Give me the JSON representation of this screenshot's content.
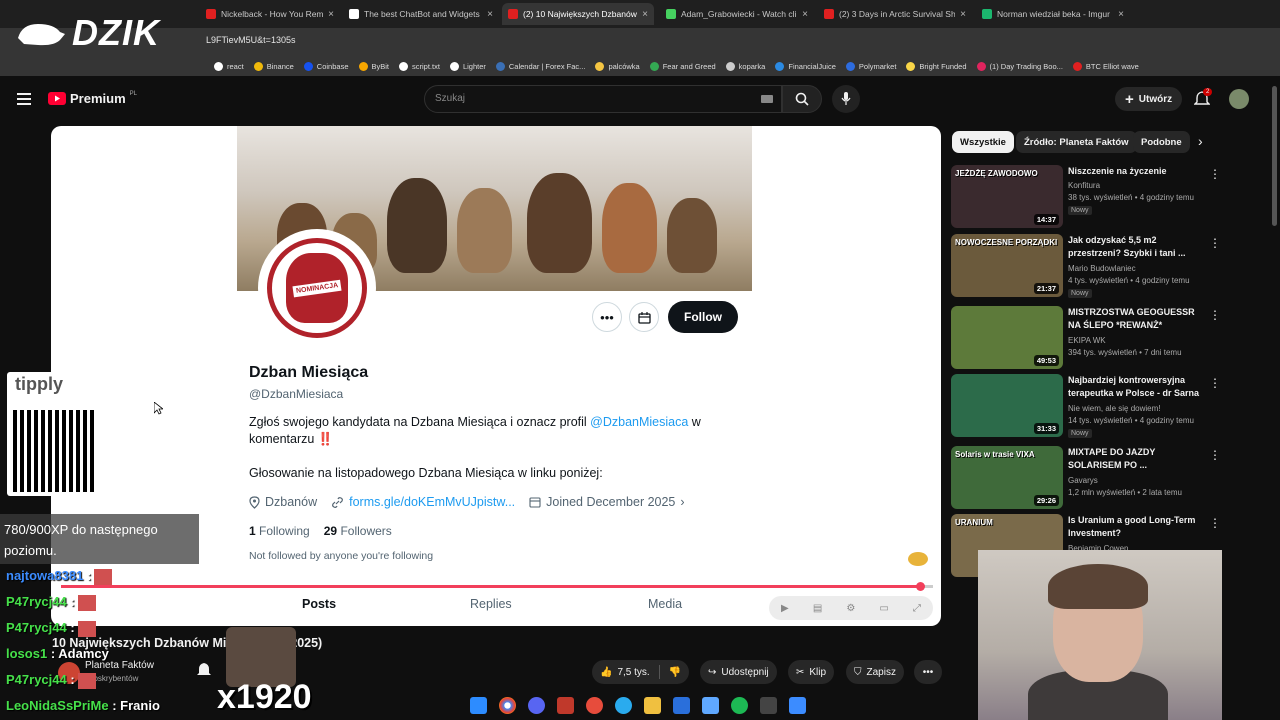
{
  "overlay": {
    "logo": "DZIK",
    "tipply": "tipply",
    "xp_text": "780/900XP do następnego poziomu.",
    "counter": "x1920",
    "chat": [
      {
        "nick": "najtowa8381",
        "text": ":"
      },
      {
        "nick": "P47rycj44",
        "text": ":"
      },
      {
        "nick": "P47rycj44",
        "text": ":"
      },
      {
        "nick": "losos1",
        "text": ": Adamcy"
      },
      {
        "nick": "P47rycj44",
        "text": ":"
      },
      {
        "nick": "LeoNidaSsPriMe",
        "text": ": Franio"
      }
    ]
  },
  "browser": {
    "tabs": [
      {
        "label": "Nickelback - How You Remi",
        "color": "#e02020"
      },
      {
        "label": "The best ChatBot and Widgets",
        "color": "#ffffff"
      },
      {
        "label": "(2) 10 Największych Dzbanów",
        "color": "#e02020"
      },
      {
        "label": "Adam_Grabowiecki - Watch cli",
        "color": "#46d160"
      },
      {
        "label": "(2) 3 Days in Arctic Survival She",
        "color": "#e02020"
      },
      {
        "label": "Norman wiedział beka - Imgur",
        "color": "#1bb76e"
      }
    ],
    "url": "L9FTievM5U&t=1305s",
    "bookmarks": [
      {
        "label": "react",
        "color": "#ffffff"
      },
      {
        "label": "Binance",
        "color": "#f0b90b"
      },
      {
        "label": "Coinbase",
        "color": "#1652f0"
      },
      {
        "label": "ByBit",
        "color": "#f7a600"
      },
      {
        "label": "script.txt",
        "color": "#ffffff"
      },
      {
        "label": "Lighter",
        "color": "#ffffff"
      },
      {
        "label": "Calendar | Forex Fac...",
        "color": "#3a6fb5"
      },
      {
        "label": "palcówka",
        "color": "#f4c542"
      },
      {
        "label": "Fear and Greed",
        "color": "#34a853"
      },
      {
        "label": "koparka",
        "color": "#cccccc"
      },
      {
        "label": "FinancialJuice",
        "color": "#2b8ae2"
      },
      {
        "label": "Polymarket",
        "color": "#2d6cdf"
      },
      {
        "label": "Bright Funded",
        "color": "#f9d648"
      },
      {
        "label": "(1) Day Trading Boo...",
        "color": "#e0245e"
      },
      {
        "label": "BTC Elliot wave",
        "color": "#e02020"
      }
    ]
  },
  "youtube": {
    "brand": "Premium",
    "brand_region": "PL",
    "search_placeholder": "Szukaj",
    "create_label": "Utwórz",
    "notif_count": "2",
    "chips": [
      "Wszystkie",
      "Źródło: Planeta Faktów",
      "Podobne"
    ],
    "video_title": "10 Największych Dzbanów Mi... (...dzień 2025)",
    "channel": "Planeta Faktów",
    "subs": "subskrybentów",
    "likes": "7,5 tys.",
    "share": "Udostępnij",
    "clip": "Klip",
    "save": "Zapisz",
    "recommended": [
      {
        "title": "Niszczenie na życzenie",
        "channel": "Konfitura",
        "meta": "38 tys. wyświetleń • 4 godziny temu",
        "badge": "Nowy",
        "duration": "14:37",
        "thumb": "#3a2a2e",
        "thumb_text": "JEŻDŻĘ ZAWODOWO"
      },
      {
        "title": "Jak odzyskać 5,5 m2 przestrzeni? Szybki i tani ...",
        "channel": "Mario Budowlaniec",
        "meta": "4 tys. wyświetleń • 4 godziny temu",
        "badge": "Nowy",
        "duration": "21:37",
        "thumb": "#6b5a3c",
        "thumb_text": "NOWOCZESNE PORZĄDKI"
      },
      {
        "title": "MISTRZOSTWA GEOGUESSR NA ŚLEPO *REWANŻ*",
        "channel": "EKIPA WK",
        "meta": "394 tys. wyświetleń • 7 dni temu",
        "badge": "",
        "duration": "49:53",
        "thumb": "#5d7a3a",
        "thumb_text": ""
      },
      {
        "title": "Najbardziej kontrowersyjna terapeutka w Polsce - dr Sarna",
        "channel": "Nie wiem, ale się dowiem!",
        "meta": "14 tys. wyświetleń • 4 godziny temu",
        "badge": "Nowy",
        "duration": "31:33",
        "thumb": "#2c6b4a",
        "thumb_text": ""
      },
      {
        "title": "MIXTAPE DO JAZDY SOLARISEM PO ...",
        "channel": "Gavarys",
        "meta": "1,2 mln wyświetleń • 2 lata temu",
        "badge": "",
        "duration": "29:26",
        "thumb": "#3f6a3a",
        "thumb_text": "Solaris w trasie VIXA"
      },
      {
        "title": "Is Uranium a good Long-Term Investment?",
        "channel": "Benjamin Cowen",
        "meta": "",
        "badge": "",
        "duration": "",
        "thumb": "#7a6a4a",
        "thumb_text": "URANIUM"
      }
    ]
  },
  "xprofile": {
    "name": "Dzban Miesiąca",
    "handle": "@DzbanMiesiaca",
    "pfp_label": "NOMINACJA",
    "bio_a": "Zgłoś swojego kandydata na Dzbana Miesiąca i oznacz profil ",
    "bio_link": "@DzbanMiesiaca",
    "bio_b": " w komentarzu ",
    "bio_bang": "‼️",
    "bio2": "Głosowanie na listopadowego Dzbana Miesiąca w linku poniżej:",
    "location": "Dzbanów",
    "link": "forms.gle/doKEmMvUJpistw...",
    "joined": "Joined December 2025",
    "following_count": "1",
    "following_label": "Following",
    "followers_count": "29",
    "followers_label": "Followers",
    "not_followed": "Not followed by anyone you're following",
    "follow_label": "Follow",
    "tabs": [
      "Posts",
      "Replies",
      "Media"
    ],
    "progress": 0.985
  },
  "colors": {
    "yt_red": "#ff0033",
    "x_blue": "#1d9bf0",
    "progress": "#f23f5b"
  }
}
